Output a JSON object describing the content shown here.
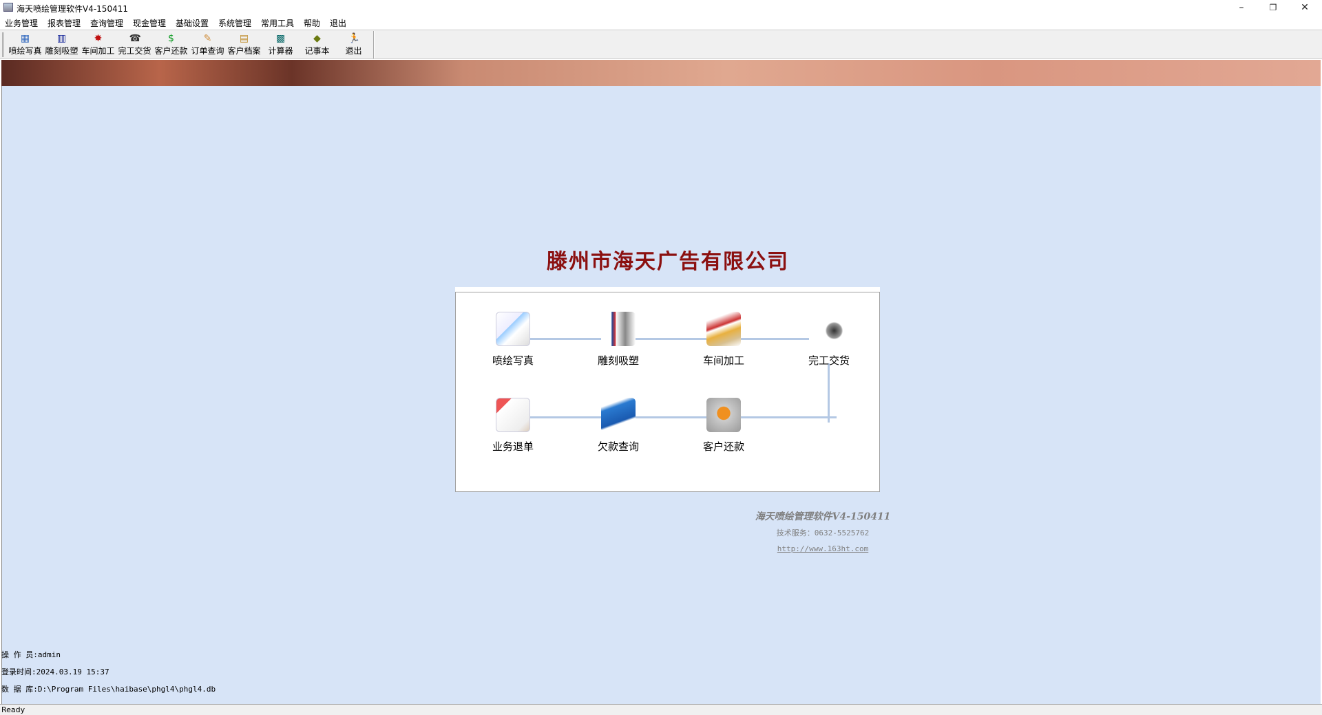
{
  "window": {
    "title": "海天喷绘管理软件V4-150411",
    "minimize": "–",
    "restore": "❐",
    "close": "✕"
  },
  "menu": [
    "业务管理",
    "报表管理",
    "查询管理",
    "现金管理",
    "基础设置",
    "系统管理",
    "常用工具",
    "帮助",
    "退出"
  ],
  "toolbar": [
    {
      "label": "喷绘写真",
      "icon": "calendar-icon",
      "glyph": "▦",
      "color": "#3a6fc0"
    },
    {
      "label": "雕刻吸塑",
      "icon": "grid-icon",
      "glyph": "▥",
      "color": "#1a2a9a"
    },
    {
      "label": "车间加工",
      "icon": "hammer-icon",
      "glyph": "✸",
      "color": "#c01010"
    },
    {
      "label": "完工交货",
      "icon": "cash-register-icon",
      "glyph": "☎",
      "color": "#333"
    },
    {
      "label": "客户还款",
      "icon": "money-bag-icon",
      "glyph": "$",
      "color": "#0a9a20"
    },
    {
      "label": "订单查询",
      "icon": "brush-icon",
      "glyph": "✎",
      "color": "#d09040"
    },
    {
      "label": "客户档案",
      "icon": "clipboard-icon",
      "glyph": "▤",
      "color": "#c09030"
    },
    {
      "label": "计算器",
      "icon": "calculator-icon",
      "glyph": "▩",
      "color": "#0a6a6a"
    },
    {
      "label": "记事本",
      "icon": "book-icon",
      "glyph": "◆",
      "color": "#6a7a10"
    },
    {
      "label": "退出",
      "icon": "running-man-icon",
      "glyph": "🏃",
      "color": "#1a1a6a"
    }
  ],
  "company_name": "滕州市海天广告有限公司",
  "flow": [
    {
      "label": "喷绘写真",
      "icon": "text-edit-icon"
    },
    {
      "label": "雕刻吸塑",
      "icon": "drafting-tools-icon"
    },
    {
      "label": "车间加工",
      "icon": "pencil-ruler-icon"
    },
    {
      "label": "完工交货",
      "icon": "photo-loupe-icon"
    },
    {
      "label": "业务退单",
      "icon": "readme-document-icon"
    },
    {
      "label": "欠款查询",
      "icon": "blue-binder-icon"
    },
    {
      "label": "客户还款",
      "icon": "number-nine-icon"
    }
  ],
  "footer": {
    "software": "海天喷绘管理软件V4-150411",
    "tech_service": "技术服务：0632-5525762",
    "url": "http://www.163ht.com"
  },
  "info": {
    "operator": "操 作 员:admin",
    "login_time": "登录时间:2024.03.19 15:37",
    "database": "数 据 库:D:\\Program Files\\haibase\\phgl4\\phgl4.db"
  },
  "status": "Ready"
}
